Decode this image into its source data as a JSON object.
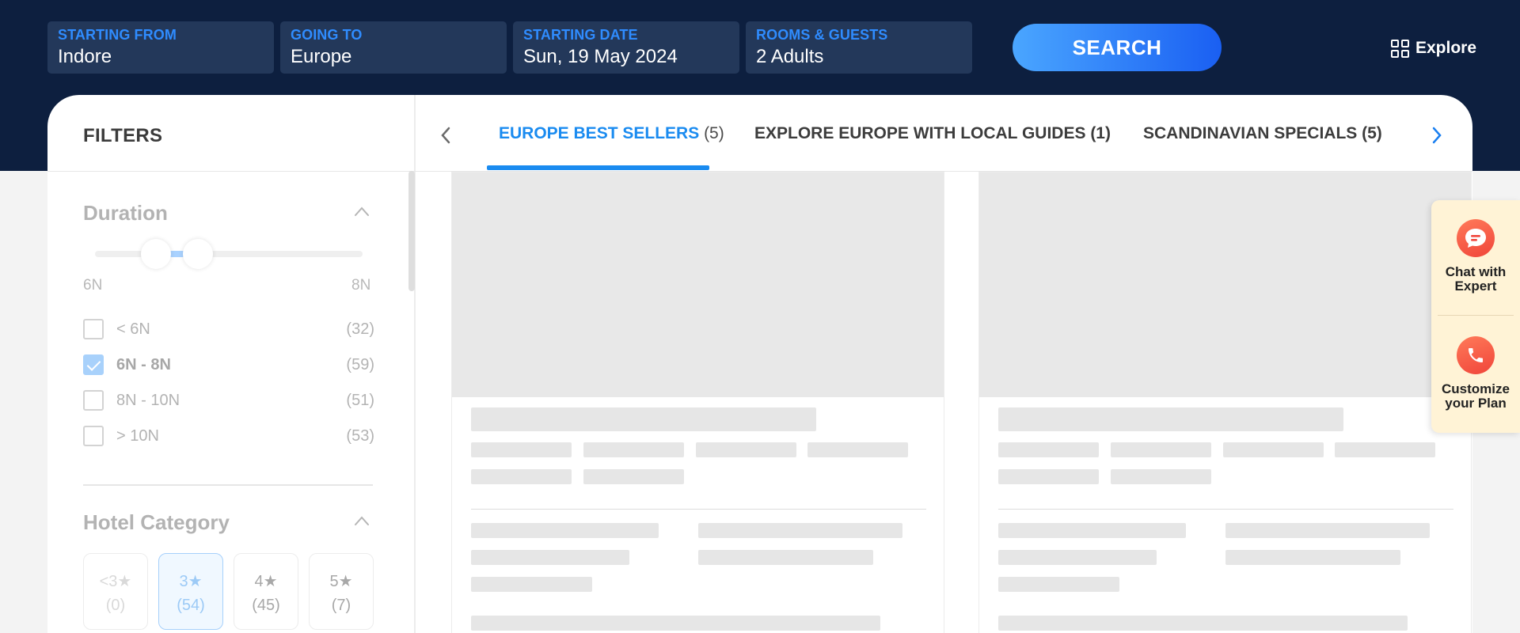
{
  "search": {
    "starting_from": {
      "label": "STARTING FROM",
      "value": "Indore"
    },
    "going_to": {
      "label": "GOING TO",
      "value": "Europe"
    },
    "starting_date": {
      "label": "STARTING DATE",
      "value": "Sun, 19 May 2024"
    },
    "rooms_guests": {
      "label": "ROOMS & GUESTS",
      "value": "2 Adults"
    },
    "search_label": "SEARCH",
    "explore_label": "Explore"
  },
  "filters": {
    "title": "FILTERS",
    "duration": {
      "title": "Duration",
      "min_label": "6N",
      "max_label": "8N",
      "options": [
        {
          "label": "< 6N",
          "count": "(32)",
          "checked": false
        },
        {
          "label": "6N - 8N",
          "count": "(59)",
          "checked": true
        },
        {
          "label": "8N - 10N",
          "count": "(51)",
          "checked": false
        },
        {
          "label": "> 10N",
          "count": "(53)",
          "checked": false
        }
      ]
    },
    "hotel_category": {
      "title": "Hotel Category",
      "options": [
        {
          "stars": "<3★",
          "count": "(0)",
          "state": "disabled"
        },
        {
          "stars": "3★",
          "count": "(54)",
          "state": "selected"
        },
        {
          "stars": "4★",
          "count": "(45)",
          "state": "default"
        },
        {
          "stars": "5★",
          "count": "(7)",
          "state": "default"
        }
      ]
    }
  },
  "tabs": [
    {
      "label": "EUROPE BEST SELLERS",
      "count": "(5)",
      "active": true
    },
    {
      "label": "EXPLORE EUROPE WITH LOCAL GUIDES (1)",
      "count": "",
      "active": false
    },
    {
      "label": "SCANDINAVIAN SPECIALS (5)",
      "count": "",
      "active": false
    }
  ],
  "side_widget": {
    "chat": {
      "line1": "Chat with",
      "line2": "Expert"
    },
    "customize": {
      "line1": "Customize",
      "line2": "your Plan"
    }
  },
  "colors": {
    "header_bg": "#0d1f3f",
    "accent": "#1a8bf0",
    "side_widget_bg": "#fff3d6"
  },
  "icons": {
    "explore": "grid-icon",
    "tab_prev": "chevron-left-icon",
    "tab_next": "chevron-right-icon",
    "collapse": "chevron-up-icon",
    "chat": "chat-bubble-icon",
    "call": "phone-icon"
  }
}
